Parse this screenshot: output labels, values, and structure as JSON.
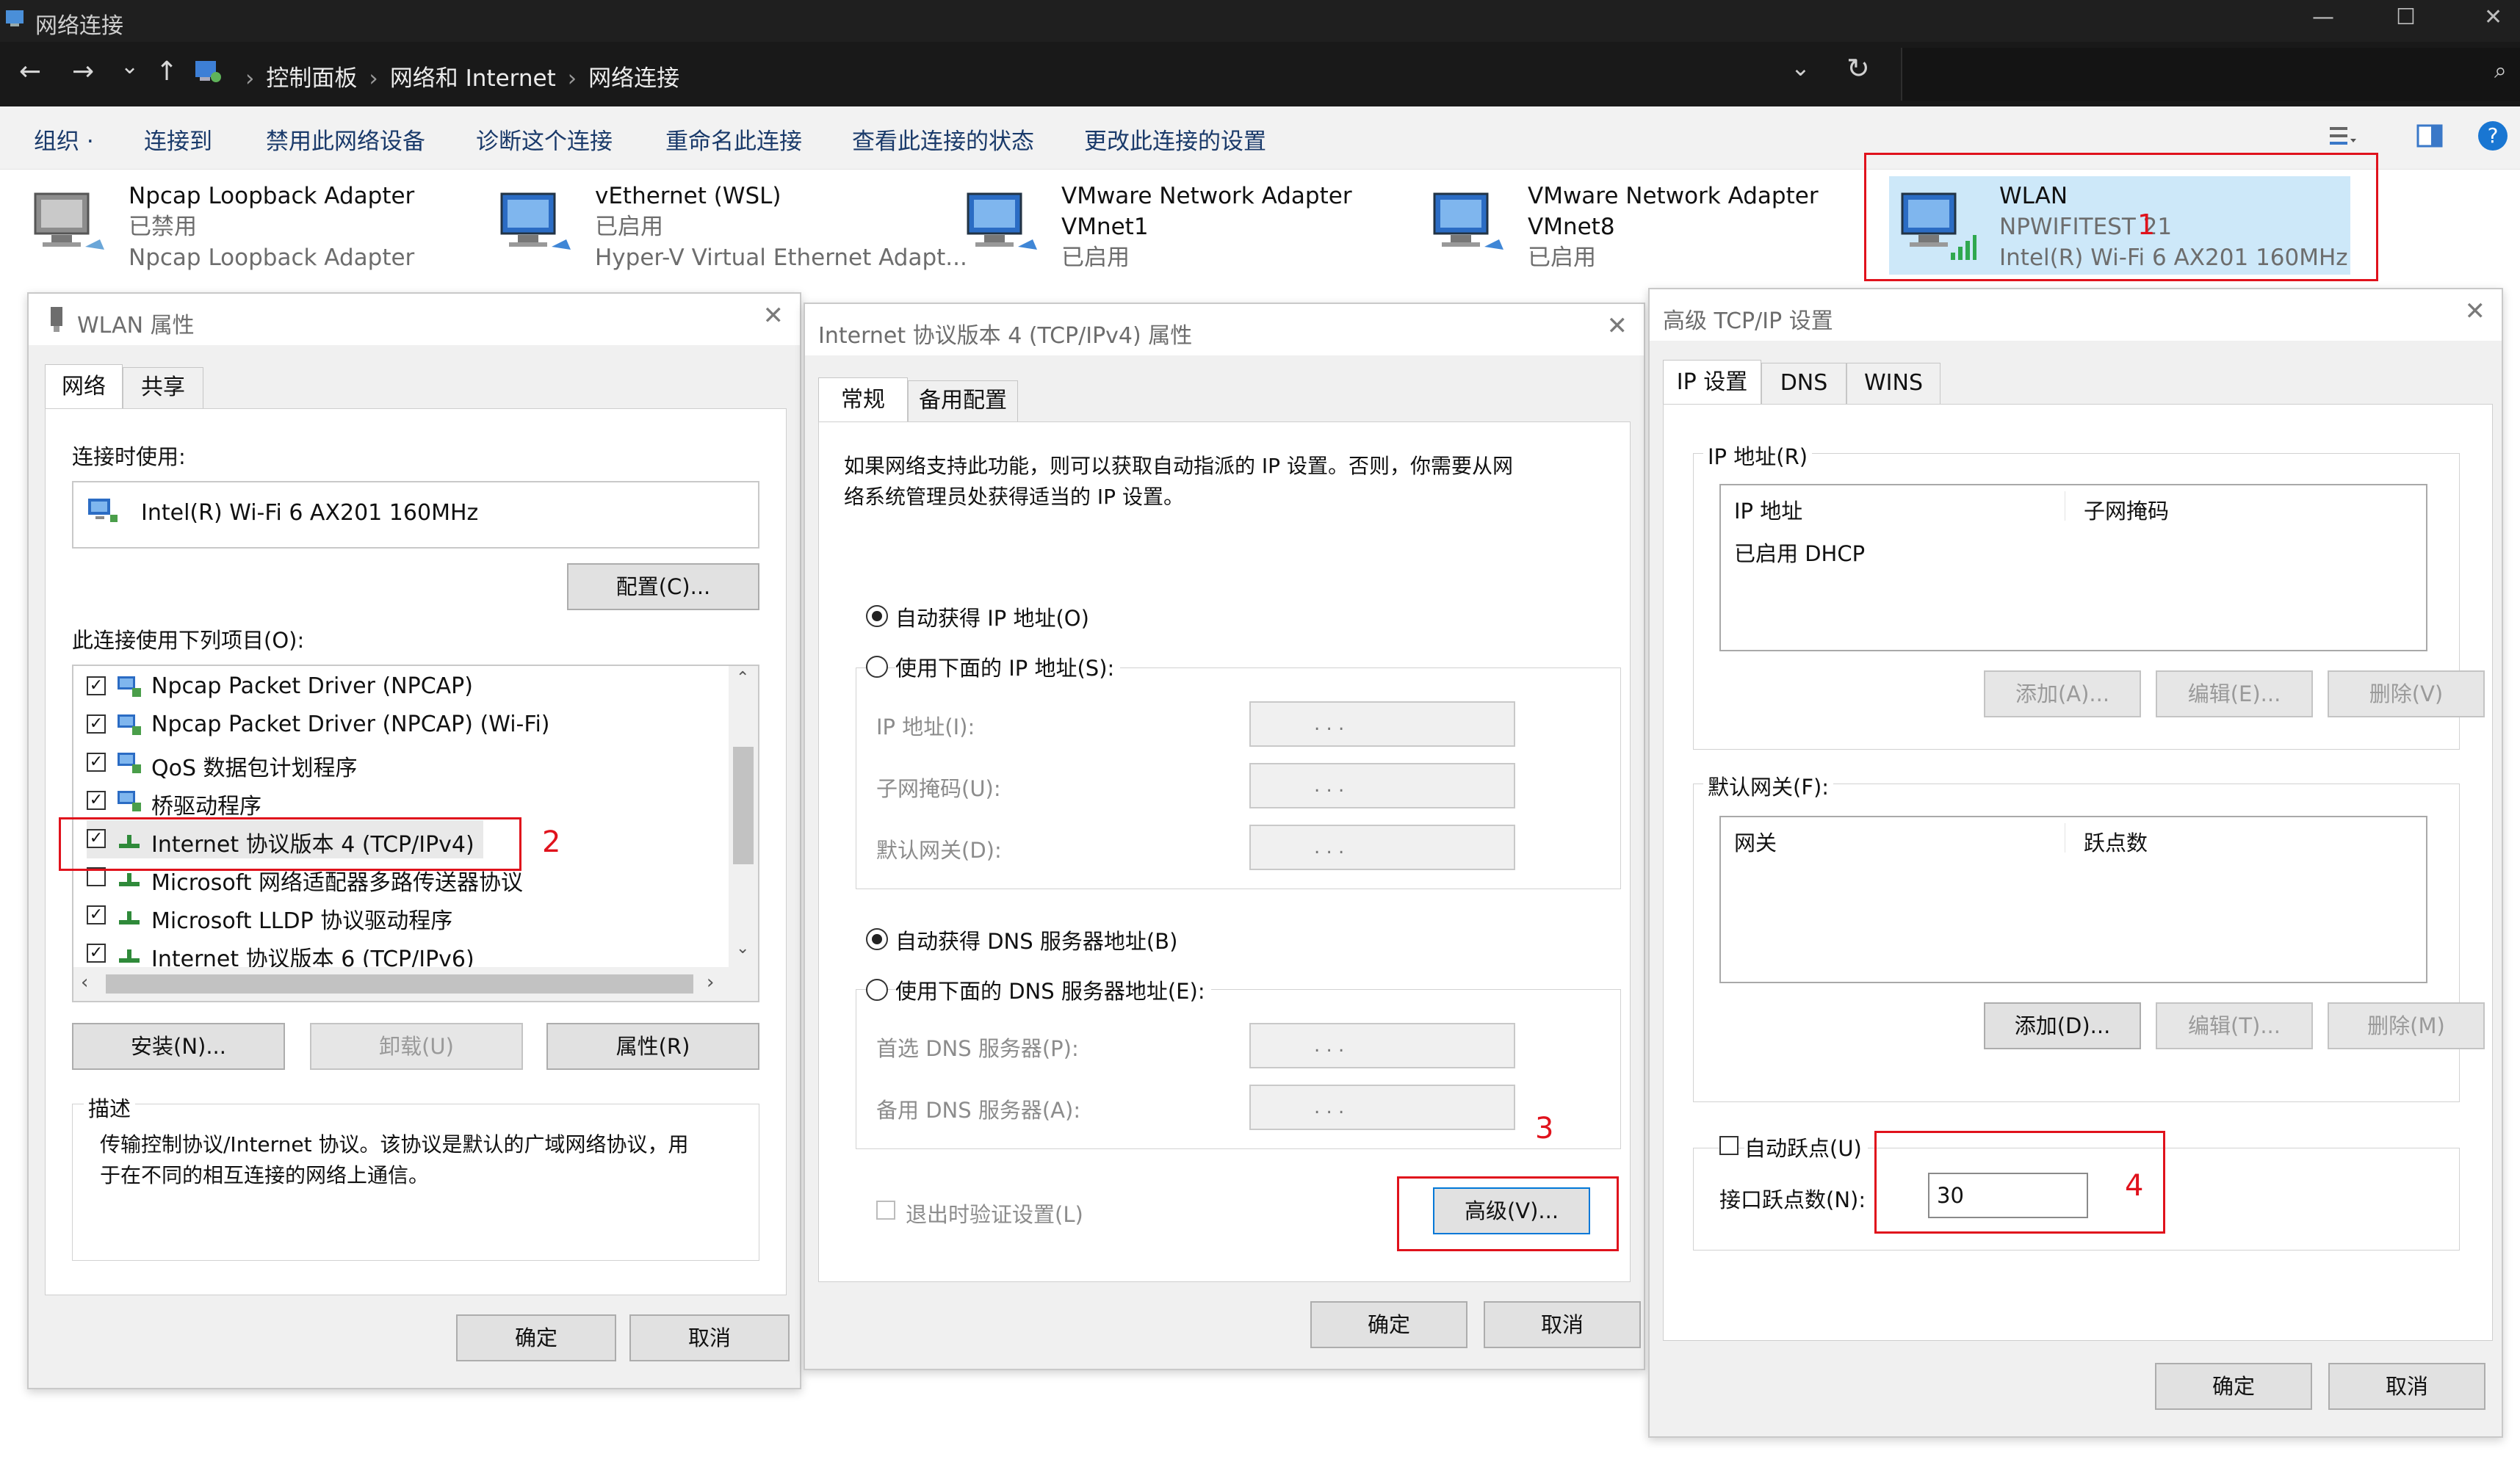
{
  "window": {
    "title": "网络连接",
    "controls": {
      "minimize": "—",
      "maximize": "☐",
      "close": "✕"
    }
  },
  "address": {
    "crumbs": [
      "控制面板",
      "网络和 Internet",
      "网络连接"
    ],
    "nav": {
      "back": "←",
      "forward": "→",
      "recent": "⌄",
      "up": "↑",
      "dropdown": "⌄",
      "refresh": "↻"
    },
    "search_icon": "🔍"
  },
  "toolbar": {
    "commands": [
      "组织 ·",
      "连接到",
      "禁用此网络设备",
      "诊断这个连接",
      "重命名此连接",
      "查看此连接的状态",
      "更改此连接的设置"
    ],
    "help": "?"
  },
  "adapters": [
    {
      "name": "Npcap Loopback Adapter",
      "status": "已禁用",
      "device": "Npcap Loopback Adapter"
    },
    {
      "name": "vEthernet (WSL)",
      "status": "已启用",
      "device": "Hyper-V Virtual Ethernet Adapt..."
    },
    {
      "name": "VMware Network Adapter",
      "status": "VMnet1",
      "device": "已启用"
    },
    {
      "name": "VMware Network Adapter",
      "status": "VMnet8",
      "device": "已启用"
    },
    {
      "name": "WLAN",
      "status": "NPWIFITEST 21",
      "device": "Intel(R) Wi-Fi 6 AX201 160MHz"
    }
  ],
  "annotations": {
    "n1": "1",
    "n2": "2",
    "n3": "3",
    "n4": "4"
  },
  "wlan_dialog": {
    "title": "WLAN 属性",
    "close": "✕",
    "tabs": [
      "网络",
      "共享"
    ],
    "connect_using_label": "连接时使用:",
    "device": "Intel(R) Wi-Fi 6 AX201 160MHz",
    "configure_button": "配置(C)...",
    "items_label": "此连接使用下列项目(O):",
    "items": [
      {
        "label": "Npcap Packet Driver (NPCAP)",
        "checked": true
      },
      {
        "label": "Npcap Packet Driver (NPCAP) (Wi-Fi)",
        "checked": true
      },
      {
        "label": "QoS 数据包计划程序",
        "checked": true
      },
      {
        "label": "桥驱动程序",
        "checked": true
      },
      {
        "label": "Internet 协议版本 4 (TCP/IPv4)",
        "checked": true
      },
      {
        "label": "Microsoft 网络适配器多路传送器协议",
        "checked": false
      },
      {
        "label": "Microsoft LLDP 协议驱动程序",
        "checked": true
      },
      {
        "label": "Internet 协议版本 6 (TCP/IPv6)",
        "checked": true
      }
    ],
    "install_button": "安装(N)...",
    "uninstall_button": "卸载(U)",
    "properties_button": "属性(R)",
    "description_title": "描述",
    "description_line1": "传输控制协议/Internet 协议。该协议是默认的广域网络协议，用",
    "description_line2": "于在不同的相互连接的网络上通信。",
    "ok": "确定",
    "cancel": "取消"
  },
  "ipv4_dialog": {
    "title": "Internet 协议版本 4 (TCP/IPv4) 属性",
    "close": "✕",
    "tabs": [
      "常规",
      "备用配置"
    ],
    "intro_line1": "如果网络支持此功能，则可以获取自动指派的 IP 设置。否则，你需要从网",
    "intro_line2": "络系统管理员处获得适当的 IP 设置。",
    "auto_ip": "自动获得 IP 地址(O)",
    "manual_ip": "使用下面的 IP 地址(S):",
    "ip_address": "IP 地址(I):",
    "subnet_mask": "子网掩码(U):",
    "default_gateway": "默认网关(D):",
    "auto_dns": "自动获得 DNS 服务器地址(B)",
    "manual_dns": "使用下面的 DNS 服务器地址(E):",
    "preferred_dns": "首选 DNS 服务器(P):",
    "alternate_dns": "备用 DNS 服务器(A):",
    "ip_dots": ".          .          .",
    "validate_on_exit": "退出时验证设置(L)",
    "advanced_button": "高级(V)...",
    "ok": "确定",
    "cancel": "取消"
  },
  "advanced_dialog": {
    "title": "高级 TCP/IP 设置",
    "close": "✕",
    "tabs": [
      "IP 设置",
      "DNS",
      "WINS"
    ],
    "ip_group": "IP 地址(R)",
    "ip_col1": "IP 地址",
    "ip_col2": "子网掩码",
    "ip_row": "已启用 DHCP",
    "ip_add": "添加(A)...",
    "ip_edit": "编辑(E)...",
    "ip_delete": "删除(V)",
    "gw_group": "默认网关(F):",
    "gw_col1": "网关",
    "gw_col2": "跃点数",
    "gw_add": "添加(D)...",
    "gw_edit": "编辑(T)...",
    "gw_delete": "删除(M)",
    "auto_metric": "自动跃点(U)",
    "interface_metric_label": "接口跃点数(N):",
    "interface_metric_value": "30",
    "ok": "确定",
    "cancel": "取消"
  }
}
